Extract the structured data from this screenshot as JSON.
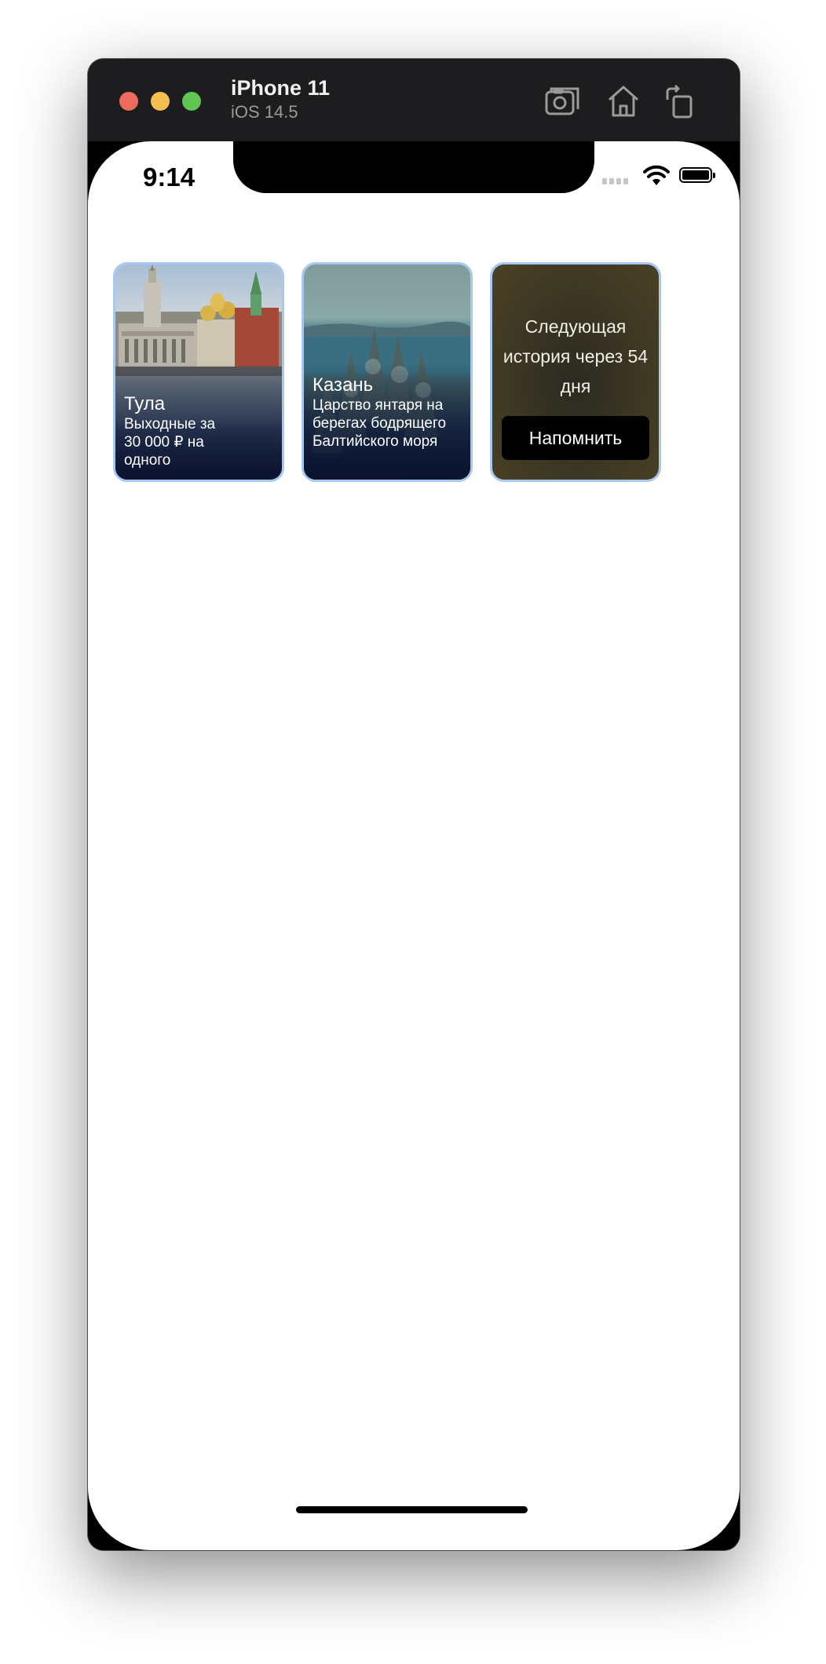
{
  "simulator": {
    "device_name": "iPhone 11",
    "os_version": "iOS 14.5",
    "toolbar_icons": [
      "screenshot-icon",
      "home-icon",
      "rotate-icon"
    ]
  },
  "status_bar": {
    "time": "9:14"
  },
  "stories": [
    {
      "title": "Тула",
      "subtitle": "Выходные за 30 000 ₽ на одного"
    },
    {
      "title": "Казань",
      "subtitle": "Царство янтаря на берегах бодрящего Балтийского моря"
    }
  ],
  "next_story": {
    "text": "Следующая история через 54 дня",
    "button_label": "Напомнить"
  },
  "colors": {
    "card_border": "#a8c8f0",
    "button_bg": "#000000",
    "screen_bg": "#ffffff"
  }
}
